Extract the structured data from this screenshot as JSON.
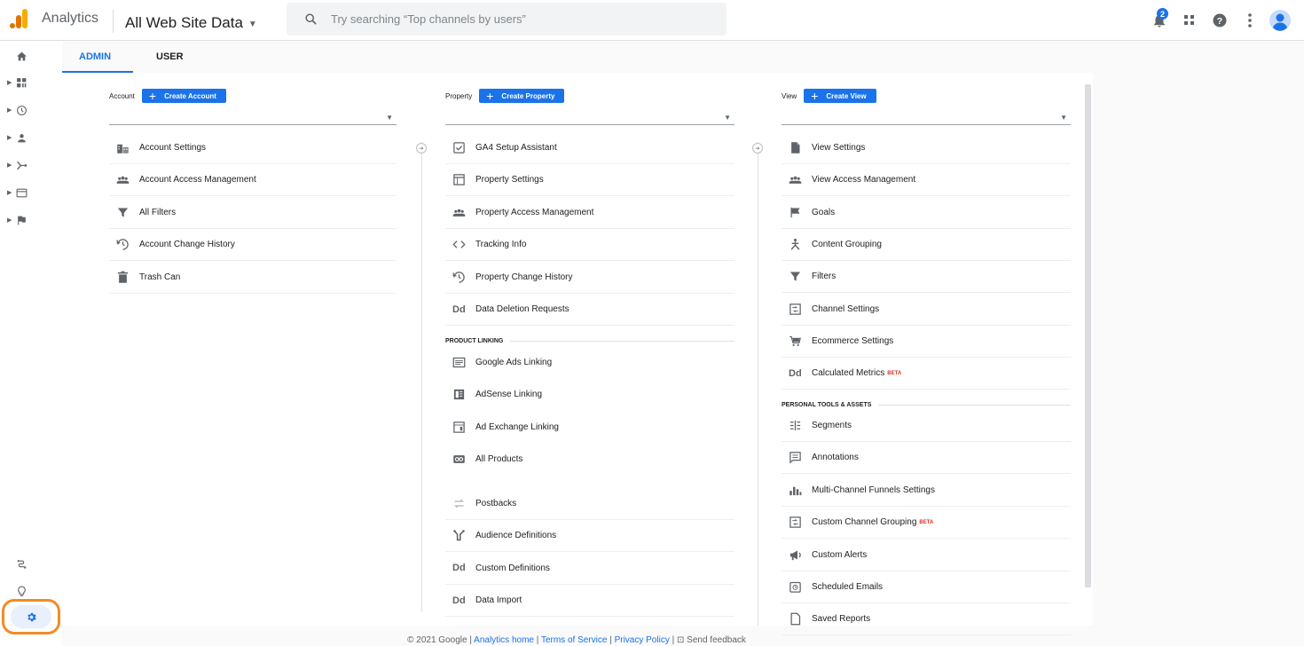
{
  "header": {
    "app_name": "Analytics",
    "account_picker": "All Web Site Data",
    "search_placeholder": "Try searching “Top channels by users”",
    "notification_count": "2"
  },
  "tabs": [
    {
      "label": "ADMIN",
      "active": true
    },
    {
      "label": "USER",
      "active": false
    }
  ],
  "account": {
    "label": "Account",
    "create_label": "Create Account",
    "items": [
      {
        "icon": "building-icon",
        "label": "Account Settings"
      },
      {
        "icon": "people-icon",
        "label": "Account Access Management"
      },
      {
        "icon": "filter-icon",
        "label": "All Filters"
      },
      {
        "icon": "history-icon",
        "label": "Account Change History"
      },
      {
        "icon": "trash-icon",
        "label": "Trash Can"
      }
    ]
  },
  "property": {
    "label": "Property",
    "create_label": "Create Property",
    "items": [
      {
        "icon": "checkbox-icon",
        "label": "GA4 Setup Assistant"
      },
      {
        "icon": "window-icon",
        "label": "Property Settings"
      },
      {
        "icon": "people-icon",
        "label": "Property Access Management"
      },
      {
        "icon": "code-icon",
        "label": "Tracking Info"
      },
      {
        "icon": "history-icon",
        "label": "Property Change History"
      },
      {
        "icon": "dd-icon",
        "label": "Data Deletion Requests"
      }
    ],
    "section_label": "PRODUCT LINKING",
    "linking_items": [
      {
        "icon": "ads-icon",
        "label": "Google Ads Linking"
      },
      {
        "icon": "adsense-icon",
        "label": "AdSense Linking"
      },
      {
        "icon": "adexchange-icon",
        "label": "Ad Exchange Linking"
      },
      {
        "icon": "link-icon",
        "label": "All Products"
      }
    ],
    "other_items": [
      {
        "icon": "postbacks-icon",
        "label": "Postbacks"
      },
      {
        "icon": "audience-icon",
        "label": "Audience Definitions"
      },
      {
        "icon": "dd-icon",
        "label": "Custom Definitions"
      },
      {
        "icon": "dd-icon",
        "label": "Data Import"
      }
    ]
  },
  "view": {
    "label": "View",
    "create_label": "Create View",
    "items": [
      {
        "icon": "document-icon",
        "label": "View Settings"
      },
      {
        "icon": "people-icon",
        "label": "View Access Management"
      },
      {
        "icon": "flag-icon",
        "label": "Goals"
      },
      {
        "icon": "grouping-icon",
        "label": "Content Grouping"
      },
      {
        "icon": "filter-icon",
        "label": "Filters"
      },
      {
        "icon": "channel-icon",
        "label": "Channel Settings"
      },
      {
        "icon": "cart-icon",
        "label": "Ecommerce Settings"
      },
      {
        "icon": "dd-icon",
        "label": "Calculated Metrics",
        "beta": "BETA"
      }
    ],
    "section_label": "PERSONAL TOOLS & ASSETS",
    "personal_items": [
      {
        "icon": "segments-icon",
        "label": "Segments"
      },
      {
        "icon": "comment-icon",
        "label": "Annotations"
      },
      {
        "icon": "bar-chart-icon",
        "label": "Multi-Channel Funnels Settings"
      },
      {
        "icon": "channel-icon",
        "label": "Custom Channel Grouping",
        "beta": "BETA"
      },
      {
        "icon": "megaphone-icon",
        "label": "Custom Alerts"
      },
      {
        "icon": "clock-icon",
        "label": "Scheduled Emails"
      },
      {
        "icon": "document-outline-icon",
        "label": "Saved Reports"
      }
    ]
  },
  "footer": {
    "copyright": "© 2021 Google |",
    "analytics_home": "Analytics home",
    "terms": "Terms of Service",
    "privacy": "Privacy Policy",
    "feedback": "Send feedback"
  },
  "colors": {
    "accent": "#1a73e8",
    "highlight_ring": "#f28b25"
  }
}
